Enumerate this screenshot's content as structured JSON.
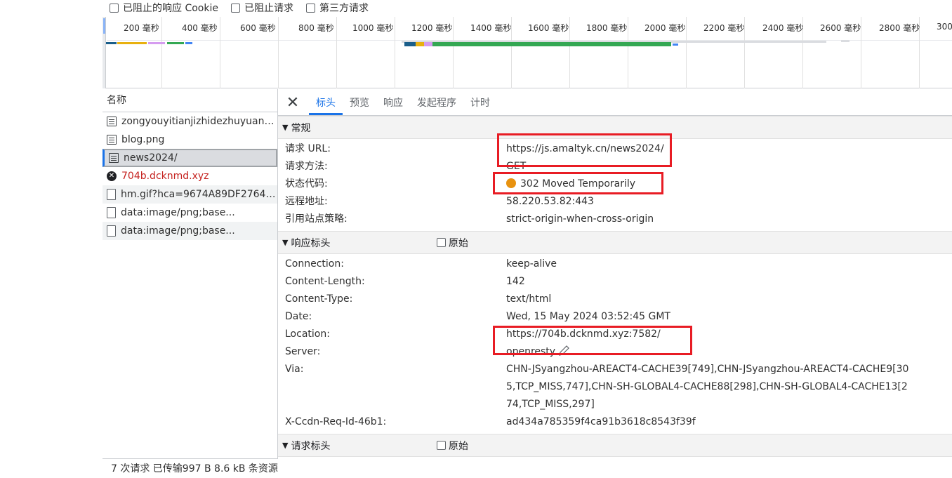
{
  "filters": {
    "blocked_cookies": "已阻止的响应 Cookie",
    "blocked_requests": "已阻止请求",
    "third_party": "第三方请求"
  },
  "timeline": {
    "ticks": [
      "200 毫秒",
      "400 毫秒",
      "600 毫秒",
      "800 毫秒",
      "1000 毫秒",
      "1200 毫秒",
      "1400 毫秒",
      "1600 毫秒",
      "1800 毫秒",
      "2000 毫秒",
      "2200 毫秒",
      "2400 毫秒",
      "2600 毫秒",
      "2800 毫秒",
      "3000"
    ]
  },
  "request_list": {
    "header": "名称",
    "items": [
      {
        "name": "zongyouyitianjizhidezhuyuanyi...",
        "icon": "document-icon"
      },
      {
        "name": "blog.png",
        "icon": "document-icon"
      },
      {
        "name": "news2024/",
        "icon": "document-icon"
      },
      {
        "name": "704b.dcknmd.xyz",
        "icon": "error-icon"
      },
      {
        "name": "hm.gif?hca=9674A89DF27643...",
        "icon": "image-file-icon"
      },
      {
        "name": "data:image/png;base...",
        "icon": "image-file-icon"
      },
      {
        "name": "data:image/png;base...",
        "icon": "image-file-icon"
      }
    ],
    "status_bar": "7 次请求  已传输997 B  8.6 kB 条资源"
  },
  "detail": {
    "tabs": [
      "标头",
      "预览",
      "响应",
      "发起程序",
      "计时"
    ],
    "general": {
      "title": "常规",
      "rows": [
        {
          "key": "请求 URL:",
          "value": "https://js.amaltyk.cn/news2024/"
        },
        {
          "key": "请求方法:",
          "value": "GET"
        },
        {
          "key": "状态代码:",
          "value": "302 Moved Temporarily"
        },
        {
          "key": "远程地址:",
          "value": "58.220.53.82:443"
        },
        {
          "key": "引用站点策略:",
          "value": "strict-origin-when-cross-origin"
        }
      ]
    },
    "response_headers": {
      "title": "响应标头",
      "raw_label": "原始",
      "rows": [
        {
          "key": "Connection:",
          "value": "keep-alive"
        },
        {
          "key": "Content-Length:",
          "value": "142"
        },
        {
          "key": "Content-Type:",
          "value": "text/html"
        },
        {
          "key": "Date:",
          "value": "Wed, 15 May 2024 03:52:45 GMT"
        },
        {
          "key": "Location:",
          "value": "https://704b.dcknmd.xyz:7582/"
        },
        {
          "key": "Server:",
          "value": "openresty"
        },
        {
          "key": "Via:",
          "value": "CHN-JSyangzhou-AREACT4-CACHE39[749],CHN-JSyangzhou-AREACT4-CACHE9[305,TCP_MISS,747],CHN-SH-GLOBAL4-CACHE88[298],CHN-SH-GLOBAL4-CACHE13[274,TCP_MISS,297]"
        },
        {
          "key": "X-Ccdn-Req-Id-46b1:",
          "value": "ad434a785359f4ca91b3618c8543f39f"
        }
      ]
    },
    "request_headers": {
      "title": "请求标头",
      "raw_label": "原始"
    }
  },
  "colors": {
    "accent": "#1a73e8",
    "highlight_box": "#e81c24",
    "status_dot": "#e8920f"
  }
}
